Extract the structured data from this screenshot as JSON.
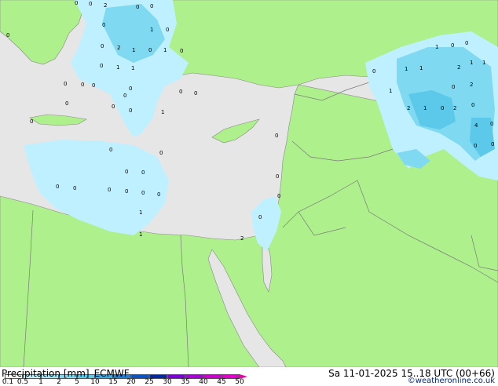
{
  "footer": {
    "title": "Precipitation [mm]",
    "model": "ECMWF",
    "time": "Sa 11-01-2025 15..18 UTC (00+66)",
    "credit": "©weatheronline.co.uk"
  },
  "legend": {
    "ticks": [
      "0.1",
      "0.5",
      "1",
      "2",
      "5",
      "10",
      "15",
      "20",
      "25",
      "30",
      "35",
      "40",
      "45",
      "50"
    ],
    "colors": [
      "#f5fdf5",
      "#bff0ff",
      "#9ee6f5",
      "#7fd9f0",
      "#5cc8ea",
      "#3fa9e0",
      "#1e7fd4",
      "#0a52c0",
      "#04279e",
      "#7a00d6",
      "#a800d8",
      "#cc00cc",
      "#e000c8",
      "#f000a8"
    ]
  },
  "colors": {
    "land": "#aef08c",
    "sea": "#e6e6e6",
    "precip_light": "#bff0ff",
    "precip_mid": "#9ee6f5",
    "precip_heavy": "#5cc8ea",
    "border": "#7a7a7a"
  },
  "map_labels": [
    "0",
    "0",
    "2",
    "0",
    "0",
    "0",
    "0",
    "1",
    "0",
    "0",
    "2",
    "1",
    "0",
    "1",
    "0",
    "0",
    "1",
    "1",
    "0",
    "0",
    "0",
    "0",
    "0",
    "0",
    "0",
    "0",
    "0",
    "0",
    "0",
    "1",
    "0",
    "0",
    "0",
    "0",
    "0",
    "0",
    "0",
    "0",
    "0",
    "0",
    "0",
    "0",
    "0",
    "0",
    "0",
    "1",
    "1",
    "2",
    "1",
    "2",
    "0",
    "0",
    "1",
    "1",
    "1",
    "1",
    "0",
    "2",
    "2",
    "1",
    "0",
    "2",
    "0",
    "1",
    "4",
    "0",
    "0",
    "0"
  ]
}
